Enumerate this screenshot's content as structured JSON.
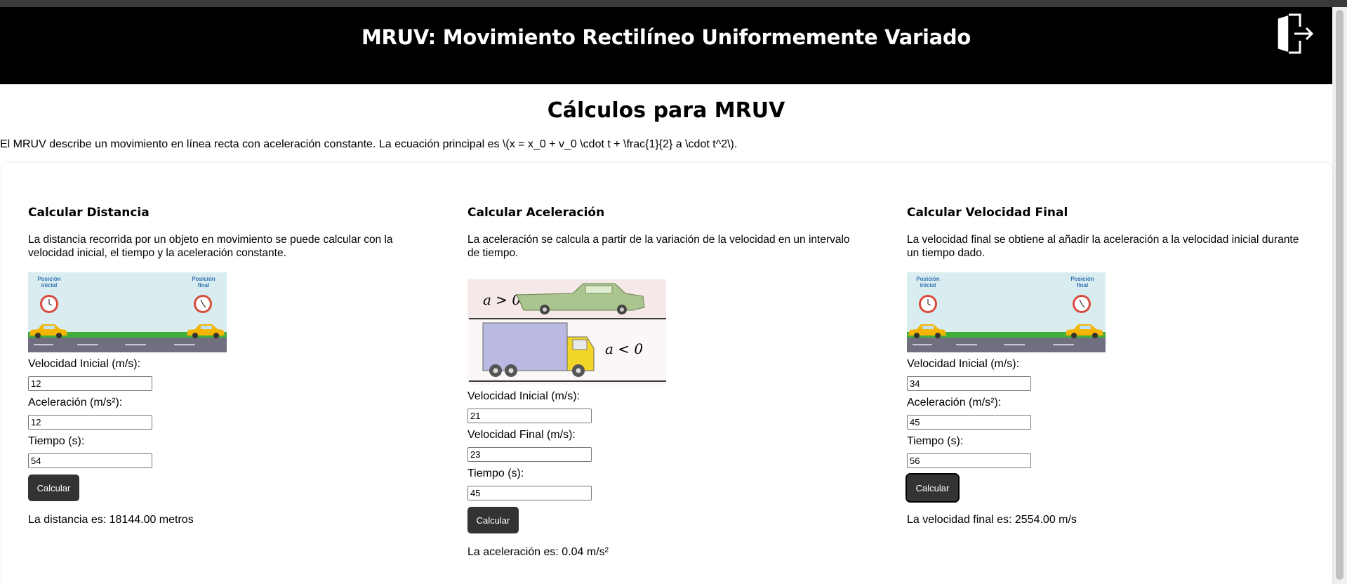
{
  "header": {
    "title": "MRUV: Movimiento Rectilíneo Uniformemente Variado",
    "exit_icon": "exit-door-icon"
  },
  "page": {
    "title": "Cálculos para MRUV",
    "intro": "El MRUV describe un movimiento en línea recta con aceleración constante. La ecuación principal es \\(x = x_0 + v_0 \\cdot t + \\frac{1}{2} a \\cdot t^2\\)."
  },
  "distance": {
    "heading": "Calcular Distancia",
    "description": "La distancia recorrida por un objeto en movimiento se puede calcular con la velocidad inicial, el tiempo y la aceleración constante.",
    "image": {
      "label_start": [
        "Posición",
        "inicial"
      ],
      "label_end": [
        "Posición",
        "final"
      ]
    },
    "fields": [
      {
        "label": "Velocidad Inicial (m/s):",
        "value": "12"
      },
      {
        "label": "Aceleración (m/s²):",
        "value": "12"
      },
      {
        "label": "Tiempo (s):",
        "value": "54"
      }
    ],
    "button": "Calcular",
    "result": "La distancia es: 18144.00 metros"
  },
  "acceleration": {
    "heading": "Calcular Aceleración",
    "description": "La aceleración se calcula a partir de la variación de la velocidad en un intervalo de tiempo.",
    "image": {
      "label_top": "a > 0",
      "label_bottom": "a < 0"
    },
    "fields": [
      {
        "label": "Velocidad Inicial (m/s):",
        "value": "21"
      },
      {
        "label": "Velocidad Final (m/s):",
        "value": "23"
      },
      {
        "label": "Tiempo (s):",
        "value": "45"
      }
    ],
    "button": "Calcular",
    "result": "La aceleración es: 0.04 m/s²"
  },
  "final_velocity": {
    "heading": "Calcular Velocidad Final",
    "description": "La velocidad final se obtiene al añadir la aceleración a la velocidad inicial durante un tiempo dado.",
    "image": {
      "label_start": [
        "Posición",
        "inicial"
      ],
      "label_end": [
        "Posición",
        "final"
      ]
    },
    "fields": [
      {
        "label": "Velocidad Inicial (m/s):",
        "value": "34"
      },
      {
        "label": "Aceleración (m/s²):",
        "value": "45"
      },
      {
        "label": "Tiempo (s):",
        "value": "56"
      }
    ],
    "button": "Calcular",
    "result": "La velocidad final es: 2554.00 m/s"
  }
}
